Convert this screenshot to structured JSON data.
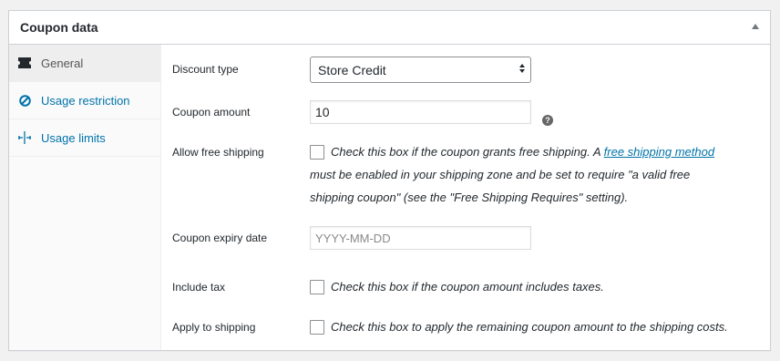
{
  "panel": {
    "title": "Coupon data"
  },
  "tabs": [
    {
      "label": "General",
      "icon": "ticket-icon",
      "active": true
    },
    {
      "label": "Usage restriction",
      "icon": "block-icon",
      "active": false
    },
    {
      "label": "Usage limits",
      "icon": "limits-icon",
      "active": false
    }
  ],
  "fields": {
    "discount_type": {
      "label": "Discount type",
      "value": "Store Credit"
    },
    "coupon_amount": {
      "label": "Coupon amount",
      "value": "10"
    },
    "free_shipping": {
      "label": "Allow free shipping",
      "desc_pre": "Check this box if the coupon grants free shipping. A ",
      "link": "free shipping method",
      "desc_line1_end": "",
      "desc_line2": "must be enabled in your shipping zone and be set to require \"a valid free",
      "desc_line3": "shipping coupon\" (see the \"Free Shipping Requires\" setting)."
    },
    "expiry_date": {
      "label": "Coupon expiry date",
      "placeholder": "YYYY-MM-DD"
    },
    "include_tax": {
      "label": "Include tax",
      "desc": "Check this box if the coupon amount includes taxes."
    },
    "apply_shipping": {
      "label": "Apply to shipping",
      "desc": "Check this box to apply the remaining coupon amount to the shipping costs."
    }
  },
  "colors": {
    "link": "#0073aa",
    "border": "#ccd0d4"
  }
}
